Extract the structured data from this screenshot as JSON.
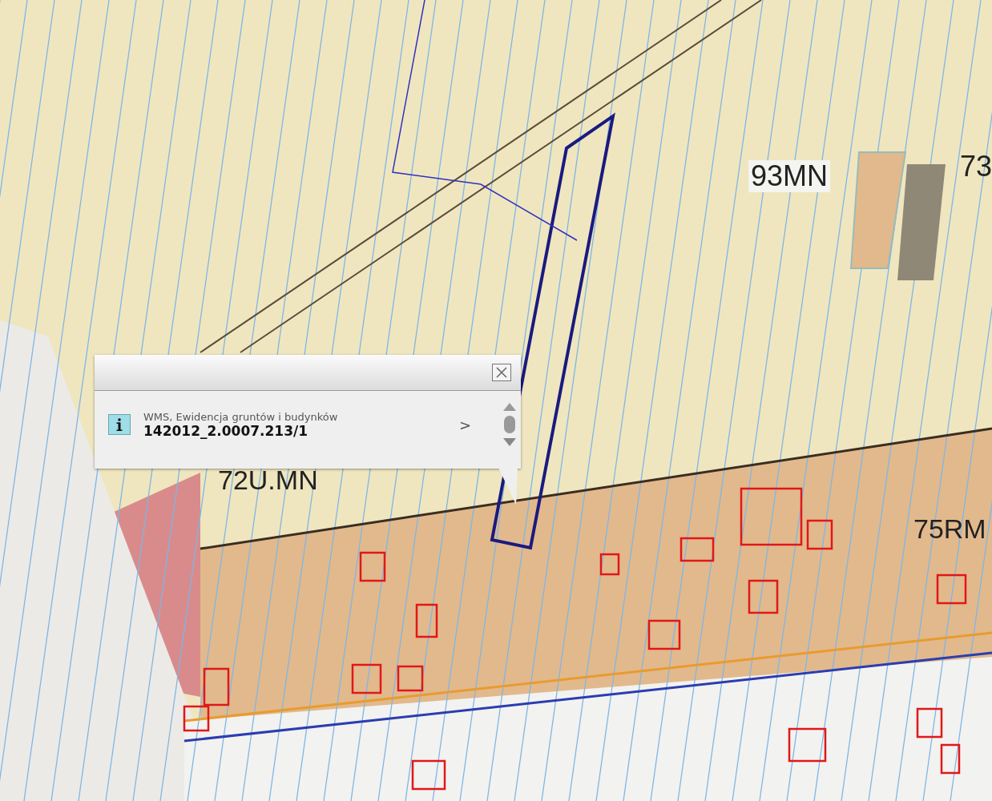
{
  "map": {
    "labels": [
      {
        "text": "93MN",
        "kind": "boxed"
      },
      {
        "text": "73",
        "kind": "plain"
      },
      {
        "text": "72U.MN",
        "kind": "plain"
      },
      {
        "text": "75RM",
        "kind": "plain"
      }
    ]
  },
  "popup": {
    "source": "WMS, Ewidencja gruntów i budynków",
    "parcel_id": "142012_2.0007.213/1",
    "next": ">"
  }
}
